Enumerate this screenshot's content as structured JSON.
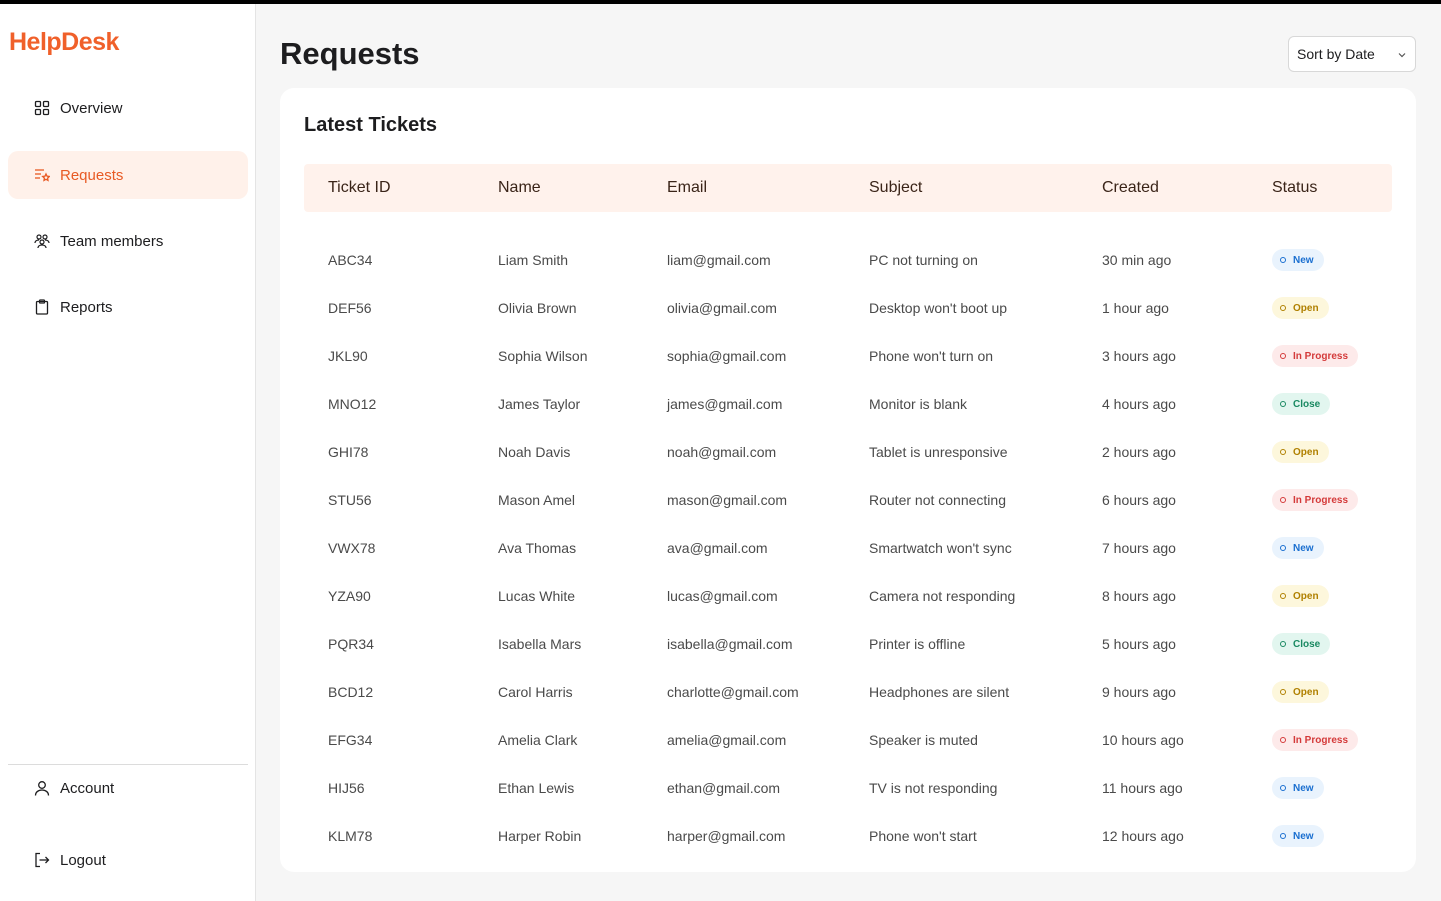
{
  "app": {
    "name": "HelpDesk"
  },
  "sidebar": {
    "items": [
      {
        "label": "Overview",
        "icon": "grid-icon"
      },
      {
        "label": "Requests",
        "icon": "list-star-icon",
        "active": true
      },
      {
        "label": "Team members",
        "icon": "users-icon"
      },
      {
        "label": "Reports",
        "icon": "clipboard-icon"
      }
    ],
    "bottom": [
      {
        "label": "Account",
        "icon": "user-icon"
      },
      {
        "label": "Logout",
        "icon": "logout-icon"
      }
    ]
  },
  "page": {
    "title": "Requests"
  },
  "sort": {
    "selected": "Sort by Date"
  },
  "card": {
    "title": "Latest Tickets"
  },
  "table": {
    "headers": [
      "Ticket ID",
      "Name",
      "Email",
      "Subject",
      "Created",
      "Status"
    ],
    "rows": [
      {
        "id": "ABC34",
        "name": "Liam Smith",
        "email": "liam@gmail.com",
        "subject": "PC not turning on",
        "created": "30 min ago",
        "status": "New"
      },
      {
        "id": "DEF56",
        "name": "Olivia Brown",
        "email": "olivia@gmail.com",
        "subject": "Desktop won't boot up",
        "created": "1 hour ago",
        "status": "Open"
      },
      {
        "id": "JKL90",
        "name": "Sophia Wilson",
        "email": "sophia@gmail.com",
        "subject": "Phone won't turn on",
        "created": "3 hours ago",
        "status": "In Progress"
      },
      {
        "id": "MNO12",
        "name": "James Taylor",
        "email": "james@gmail.com",
        "subject": "Monitor is blank",
        "created": "4 hours ago",
        "status": "Close"
      },
      {
        "id": "GHI78",
        "name": "Noah Davis",
        "email": "noah@gmail.com",
        "subject": "Tablet is unresponsive",
        "created": "2 hours ago",
        "status": "Open"
      },
      {
        "id": "STU56",
        "name": "Mason Amel",
        "email": "mason@gmail.com",
        "subject": "Router not connecting",
        "created": "6 hours ago",
        "status": "In Progress"
      },
      {
        "id": "VWX78",
        "name": "Ava Thomas",
        "email": "ava@gmail.com",
        "subject": "Smartwatch won't sync",
        "created": "7 hours ago",
        "status": "New"
      },
      {
        "id": "YZA90",
        "name": "Lucas White",
        "email": "lucas@gmail.com",
        "subject": "Camera not responding",
        "created": "8 hours ago",
        "status": "Open"
      },
      {
        "id": "PQR34",
        "name": "Isabella Mars",
        "email": "isabella@gmail.com",
        "subject": "Printer is offline",
        "created": "5 hours ago",
        "status": "Close"
      },
      {
        "id": "BCD12",
        "name": "Carol Harris",
        "email": "charlotte@gmail.com",
        "subject": "Headphones are silent",
        "created": "9 hours ago",
        "status": "Open"
      },
      {
        "id": "EFG34",
        "name": "Amelia Clark",
        "email": "amelia@gmail.com",
        "subject": "Speaker is muted",
        "created": "10 hours ago",
        "status": "In Progress"
      },
      {
        "id": "HIJ56",
        "name": "Ethan Lewis",
        "email": "ethan@gmail.com",
        "subject": "TV is not responding",
        "created": "11 hours ago",
        "status": "New"
      },
      {
        "id": "KLM78",
        "name": "Harper Robin",
        "email": "harper@gmail.com",
        "subject": "Phone won't start",
        "created": "12 hours ago",
        "status": "New"
      }
    ]
  },
  "colors": {
    "accent": "#f0602a",
    "active_bg": "#fff1ea",
    "header_bg": "#fff2ec"
  }
}
